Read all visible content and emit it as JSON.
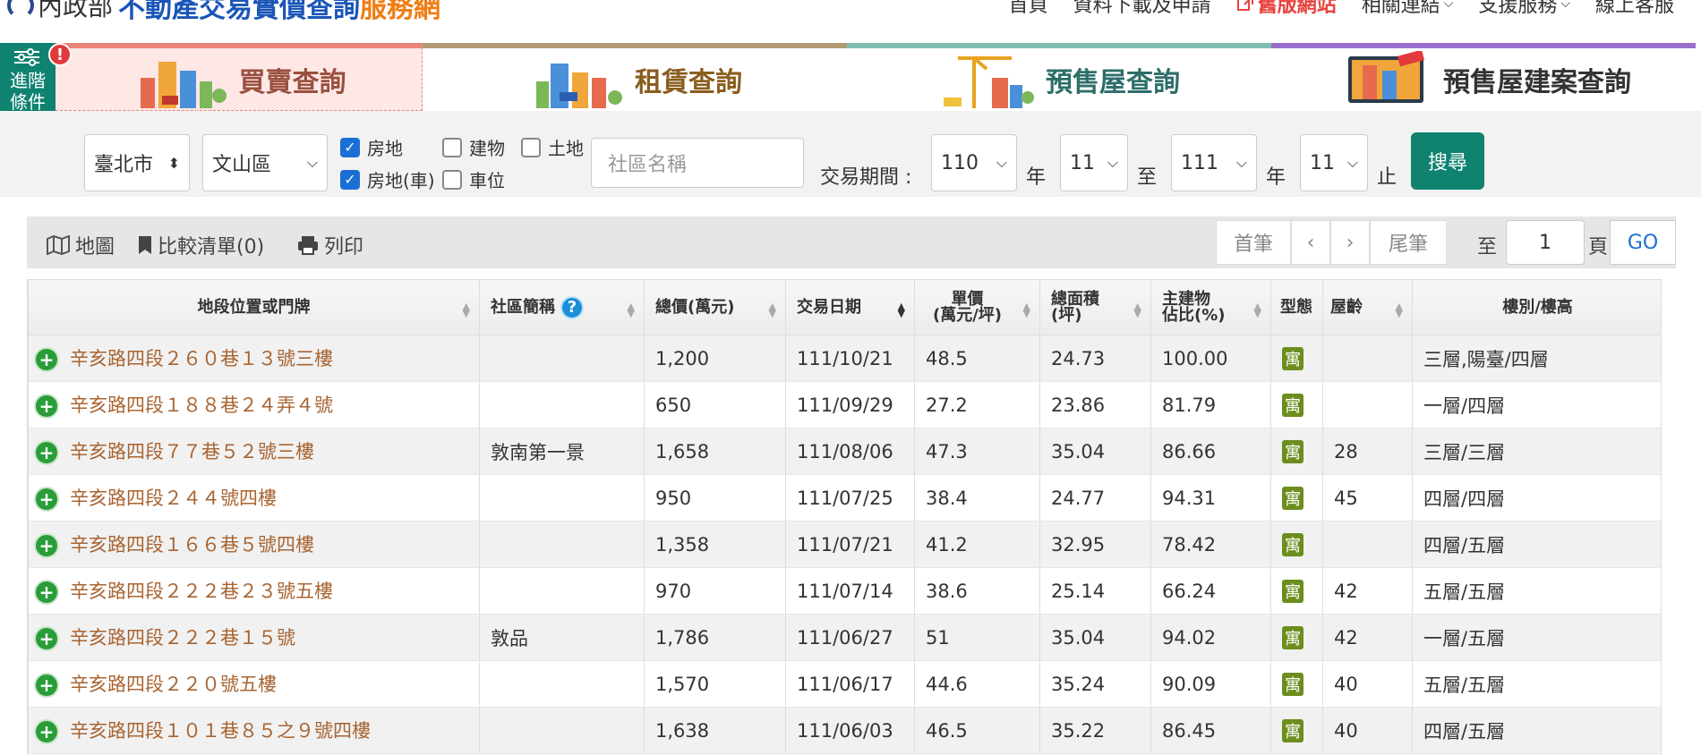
{
  "header": {
    "logo_moi": "內政部",
    "logo_main": "不動產交易實價查詢",
    "logo_sub": "服務網",
    "nav": [
      {
        "label": "首頁",
        "has_menu": false
      },
      {
        "label": "資料下載及申請",
        "has_menu": false
      },
      {
        "label": "舊版網站",
        "has_menu": false
      },
      {
        "label": "相關連結",
        "has_menu": true
      },
      {
        "label": "支援服務",
        "has_menu": true
      },
      {
        "label": "線上客服",
        "has_menu": false
      }
    ]
  },
  "advanced": {
    "label_line1": "進階",
    "label_line2": "條件",
    "badge": "!"
  },
  "categories": [
    {
      "label": "買賣查詢",
      "color": "#9a5040"
    },
    {
      "label": "租賃查詢",
      "color": "#8a5d1e"
    },
    {
      "label": "預售屋查詢",
      "color": "#2d6e69"
    },
    {
      "label": "預售屋建案查詢",
      "color": "#333333"
    }
  ],
  "filters": {
    "city": "臺北市",
    "district": "文山區",
    "types": [
      {
        "label": "房地",
        "checked": true
      },
      {
        "label": "建物",
        "checked": false
      },
      {
        "label": "土地",
        "checked": false
      },
      {
        "label": "房地(車)",
        "checked": true
      },
      {
        "label": "車位",
        "checked": false
      }
    ],
    "community_placeholder": "社區名稱",
    "period_label": "交易期間 :",
    "from_year": "110",
    "from_month": "11",
    "to_year": "111",
    "to_month": "11",
    "year_unit": "年",
    "to_label": "至",
    "end_label": "止",
    "search_label": "搜尋"
  },
  "toolbar": {
    "map_label": "地圖",
    "compare_label": "比較清單(0)",
    "print_label": "列印",
    "first_label": "首筆",
    "prev_label": "‹",
    "next_label": "›",
    "last_label": "尾筆",
    "goto_label": "至",
    "page_value": "1",
    "page_unit": "頁",
    "go_label": "GO"
  },
  "table": {
    "headers": {
      "address": "地段位置或門牌",
      "community": "社區簡稱",
      "total": "總價(萬元)",
      "date": "交易日期",
      "unit_line1": "單價",
      "unit_line2": "(萬元/坪)",
      "area_line1": "總面積",
      "area_line2": "(坪)",
      "ratio_line1": "主建物",
      "ratio_line2": "佔比(%)",
      "type": "型態",
      "age": "屋齡",
      "floor": "樓別/樓高"
    },
    "rows": [
      {
        "address": "辛亥路四段２６０巷１３號三樓",
        "community": "",
        "total": "1,200",
        "date": "111/10/21",
        "unit": "48.5",
        "area": "24.73",
        "ratio": "100.00",
        "type": "寓",
        "age": "",
        "floor": "三層,陽臺/四層"
      },
      {
        "address": "辛亥路四段１８８巷２４弄４號",
        "community": "",
        "total": "650",
        "date": "111/09/29",
        "unit": "27.2",
        "area": "23.86",
        "ratio": "81.79",
        "type": "寓",
        "age": "",
        "floor": "一層/四層"
      },
      {
        "address": "辛亥路四段７７巷５２號三樓",
        "community": "敦南第一景",
        "total": "1,658",
        "date": "111/08/06",
        "unit": "47.3",
        "area": "35.04",
        "ratio": "86.66",
        "type": "寓",
        "age": "28",
        "floor": "三層/三層"
      },
      {
        "address": "辛亥路四段２４４號四樓",
        "community": "",
        "total": "950",
        "date": "111/07/25",
        "unit": "38.4",
        "area": "24.77",
        "ratio": "94.31",
        "type": "寓",
        "age": "45",
        "floor": "四層/四層"
      },
      {
        "address": "辛亥路四段１６６巷５號四樓",
        "community": "",
        "total": "1,358",
        "date": "111/07/21",
        "unit": "41.2",
        "area": "32.95",
        "ratio": "78.42",
        "type": "寓",
        "age": "",
        "floor": "四層/五層"
      },
      {
        "address": "辛亥路四段２２２巷２３號五樓",
        "community": "",
        "total": "970",
        "date": "111/07/14",
        "unit": "38.6",
        "area": "25.14",
        "ratio": "66.24",
        "type": "寓",
        "age": "42",
        "floor": "五層/五層"
      },
      {
        "address": "辛亥路四段２２２巷１５號",
        "community": "敦品",
        "total": "1,786",
        "date": "111/06/27",
        "unit": "51",
        "area": "35.04",
        "ratio": "94.02",
        "type": "寓",
        "age": "42",
        "floor": "一層/五層"
      },
      {
        "address": "辛亥路四段２２０號五樓",
        "community": "",
        "total": "1,570",
        "date": "111/06/17",
        "unit": "44.6",
        "area": "35.24",
        "ratio": "90.09",
        "type": "寓",
        "age": "40",
        "floor": "五層/五層"
      },
      {
        "address": "辛亥路四段１０１巷８５之９號四樓",
        "community": "",
        "total": "1,638",
        "date": "111/06/03",
        "unit": "46.5",
        "area": "35.22",
        "ratio": "86.45",
        "type": "寓",
        "age": "40",
        "floor": "四層/五層"
      }
    ]
  }
}
